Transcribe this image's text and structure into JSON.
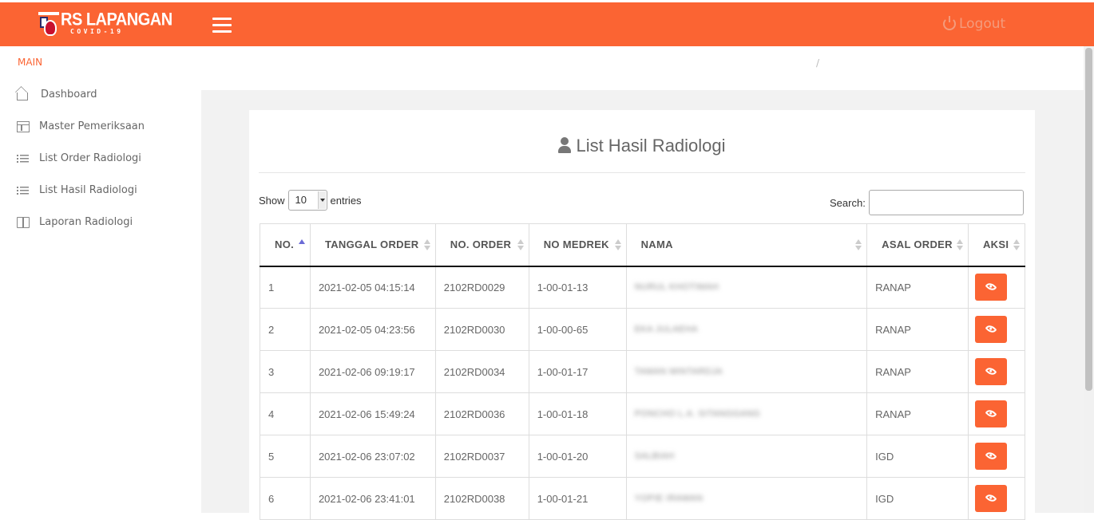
{
  "header": {
    "logo_text": "RS LAPANGAN",
    "logo_subtext": "COVID-19",
    "logout_label": "Logout"
  },
  "sidebar": {
    "heading": "MAIN",
    "items": [
      {
        "label": "Dashboard",
        "icon": "home-icon"
      },
      {
        "label": "Master Pemeriksaan",
        "icon": "table-icon"
      },
      {
        "label": "List Order Radiologi",
        "icon": "list-icon"
      },
      {
        "label": "List Hasil Radiologi",
        "icon": "list-icon"
      },
      {
        "label": "Laporan Radiologi",
        "icon": "book-icon"
      }
    ]
  },
  "breadcrumb": {
    "separator": "/"
  },
  "main": {
    "title": "List Hasil Radiologi",
    "show_label": "Show",
    "entries_value": "10",
    "entries_label": "entries",
    "search_label": "Search:",
    "search_value": ""
  },
  "table": {
    "headers": [
      "NO.",
      "TANGGAL ORDER",
      "NO. ORDER",
      "NO MEDREK",
      "NAMA",
      "ASAL ORDER",
      "AKSI"
    ],
    "rows": [
      {
        "no": "1",
        "tanggal": "2021-02-05 04:15:14",
        "order": "2102RD0029",
        "medrek": "1-00-01-13",
        "nama": "NURUL KHOTIMAH",
        "asal": "RANAP"
      },
      {
        "no": "2",
        "tanggal": "2021-02-05 04:23:56",
        "order": "2102RD0030",
        "medrek": "1-00-00-65",
        "nama": "EKA JULAEHA",
        "asal": "RANAP"
      },
      {
        "no": "3",
        "tanggal": "2021-02-06 09:19:17",
        "order": "2102RD0034",
        "medrek": "1-00-01-17",
        "nama": "TAMAN MINTARDJA",
        "asal": "RANAP"
      },
      {
        "no": "4",
        "tanggal": "2021-02-06 15:49:24",
        "order": "2102RD0036",
        "medrek": "1-00-01-18",
        "nama": "PONCHO L.A. SITANGGANG",
        "asal": "RANAP"
      },
      {
        "no": "5",
        "tanggal": "2021-02-06 23:07:02",
        "order": "2102RD0037",
        "medrek": "1-00-01-20",
        "nama": "SALBIAH",
        "asal": "IGD"
      },
      {
        "no": "6",
        "tanggal": "2021-02-06 23:41:01",
        "order": "2102RD0038",
        "medrek": "1-00-01-21",
        "nama": "YOPIE IRAWAN",
        "asal": "IGD"
      }
    ]
  },
  "colors": {
    "accent": "#fb6433",
    "background": "#f2f2f2"
  }
}
